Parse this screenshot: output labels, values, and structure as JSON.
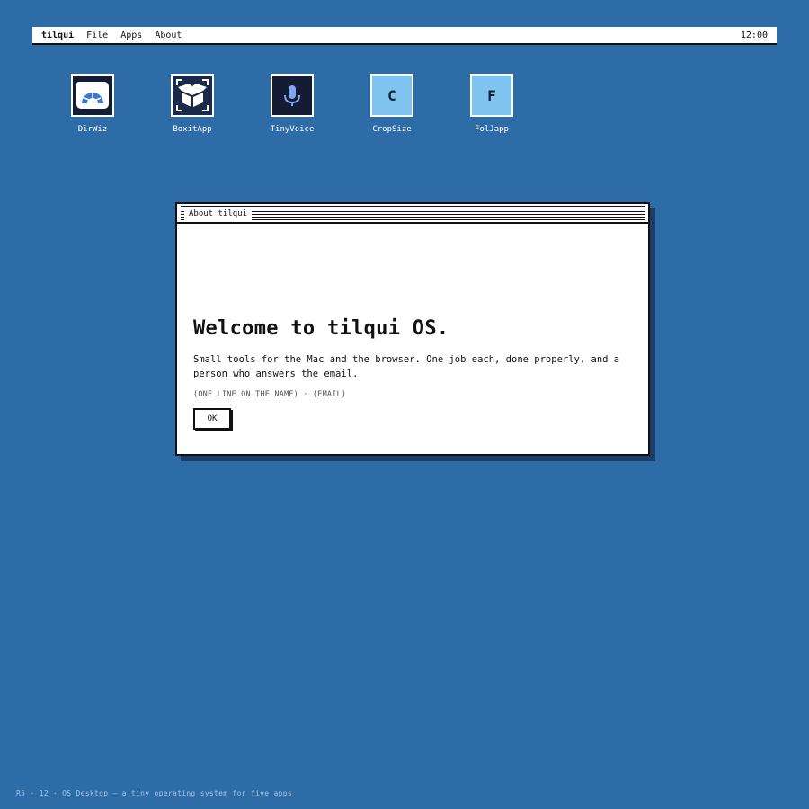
{
  "menubar": {
    "brand": "tilqui",
    "items": [
      "File",
      "Apps",
      "About"
    ],
    "clock": "12:00"
  },
  "desktop": {
    "icons": [
      {
        "label": "DirWiz",
        "icon": "gauge-folder-icon"
      },
      {
        "label": "BoxitApp",
        "icon": "box-icon"
      },
      {
        "label": "TinyVoice",
        "icon": "microphone-icon"
      },
      {
        "label": "CropSize",
        "icon": "letter-c-icon",
        "letter": "C"
      },
      {
        "label": "FolJapp",
        "icon": "letter-f-icon",
        "letter": "F"
      }
    ]
  },
  "about_window": {
    "title": "About tilqui",
    "headline": "Welcome to tilqui OS.",
    "description": "Small tools for the Mac and the browser. One job each, done properly, and a person who answers the email.",
    "contact": "(ONE LINE ON THE NAME) · (EMAIL)",
    "ok_label": "OK"
  },
  "footer": "R5 · 12 · OS Desktop — a tiny operating system for five apps",
  "colors": {
    "desktop": "#2e6ca8",
    "window": "#ffffff",
    "border": "#111111",
    "icon_light": "#7fc4ef",
    "icon_dark": "#131c33"
  }
}
